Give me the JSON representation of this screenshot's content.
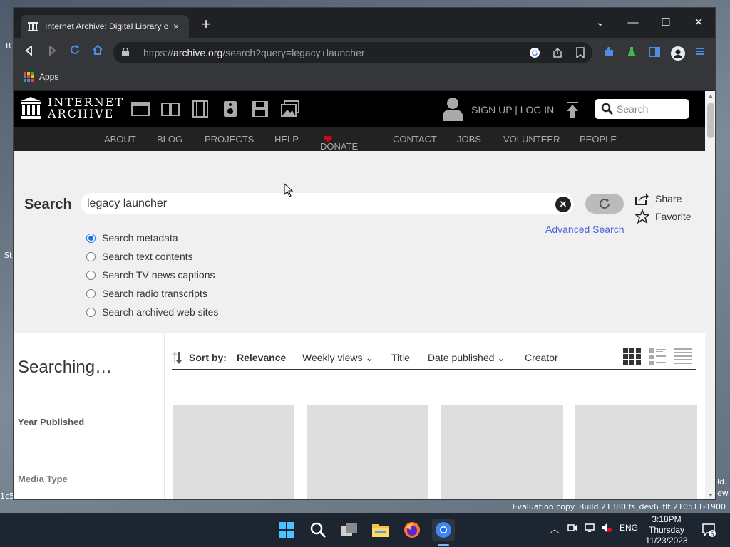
{
  "desktop": {
    "fragments": [
      "R",
      "St",
      "ld.",
      "ew",
      "1c5"
    ]
  },
  "browser": {
    "tab_title": "Internet Archive: Digital Library o",
    "tab_close": "×",
    "new_tab": "+",
    "url_prefix": "https://",
    "url_host": "archive.org",
    "url_path": "/search?query=legacy+launcher",
    "bookmarks_apps": "Apps"
  },
  "ia_header": {
    "logo_line1": "INTERNET",
    "logo_line2": "ARCHIVE",
    "sign_in": "SIGN UP | LOG IN",
    "search_placeholder": "Search",
    "nav": [
      "ABOUT",
      "BLOG",
      "PROJECTS",
      "HELP",
      "DONATE",
      "CONTACT",
      "JOBS",
      "VOLUNTEER",
      "PEOPLE"
    ]
  },
  "search": {
    "label": "Search",
    "query": "legacy launcher",
    "clear": "✕",
    "share": "Share",
    "favorite": "Favorite",
    "advanced": "Advanced Search",
    "options": [
      {
        "label": "Search metadata",
        "checked": true
      },
      {
        "label": "Search text contents",
        "checked": false
      },
      {
        "label": "Search TV news captions",
        "checked": false
      },
      {
        "label": "Search radio transcripts",
        "checked": false
      },
      {
        "label": "Search archived web sites",
        "checked": false
      }
    ]
  },
  "sidebar": {
    "status": "Searching…",
    "facet_year": "Year Published",
    "facet_loading": "···",
    "facet_media": "Media Type"
  },
  "sort": {
    "label": "Sort by:",
    "relevance": "Relevance",
    "weekly": "Weekly views",
    "title": "Title",
    "date": "Date published",
    "creator": "Creator"
  },
  "taskbar": {
    "evaluation": "Evaluation copy. Build 21380.fs_dev6_flt.210511-1900",
    "lang": "ENG",
    "time": "3:18PM",
    "day": "Thursday",
    "date": "11/23/2023",
    "notifications": "5"
  },
  "colors": {
    "accent_link": "#4b64de",
    "donate_heart": "#e0001b",
    "ia_black": "#000000"
  }
}
